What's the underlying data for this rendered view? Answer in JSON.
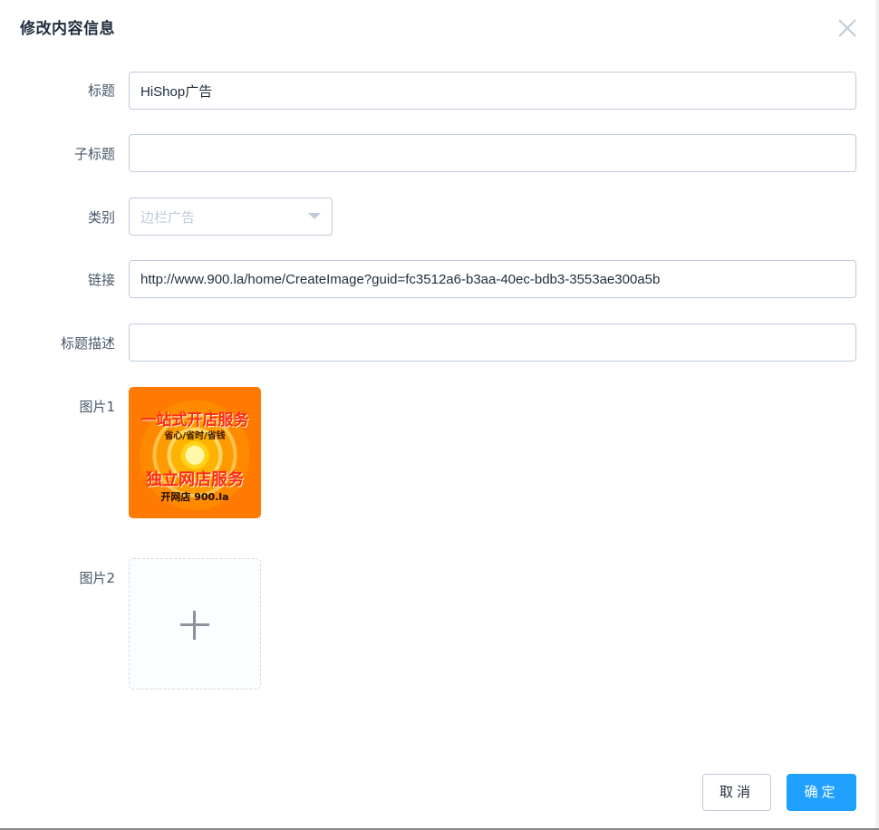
{
  "dialog": {
    "title": "修改内容信息",
    "close_icon": "close-icon"
  },
  "form": {
    "title_label": "标题",
    "title_value": "HiShop广告",
    "subtitle_label": "子标题",
    "subtitle_value": "",
    "category_label": "类别",
    "category_placeholder": "边栏广告",
    "link_label": "链接",
    "link_value": "http://www.900.la/home/CreateImage?guid=fc3512a6-b3aa-40ec-bdb3-3553ae300a5b",
    "description_label": "标题描述",
    "description_value": "",
    "image1_label": "图片1",
    "image2_label": "图片2"
  },
  "image1": {
    "line1": "一站式开店服务",
    "line2": "省心/省时/省钱",
    "line3": "独立网店服务",
    "line4": "开网店 900.la"
  },
  "footer": {
    "cancel_label": "取消",
    "confirm_label": "确定"
  },
  "colors": {
    "primary": "#20a0ff",
    "border": "#bfcbd9",
    "label": "#48576a"
  }
}
